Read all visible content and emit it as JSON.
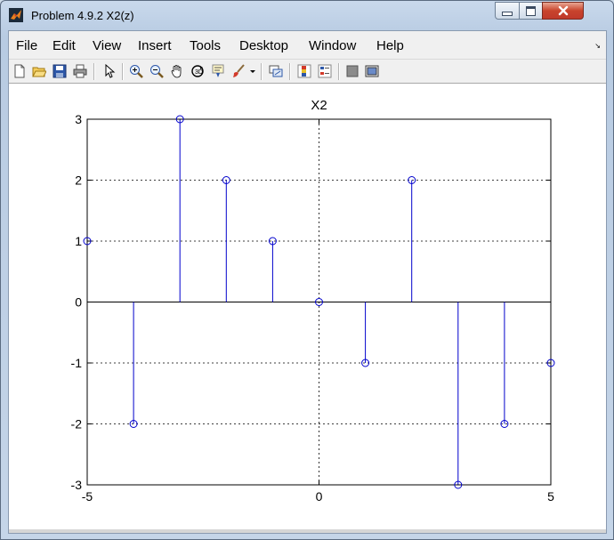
{
  "window": {
    "title": "Problem 4.9.2 X2(z)",
    "controls": {
      "minimize": "minimize",
      "maximize": "maximize",
      "close": "close"
    }
  },
  "menu": [
    "File",
    "Edit",
    "View",
    "Insert",
    "Tools",
    "Desktop",
    "Window",
    "Help"
  ],
  "toolbar": {
    "icons": [
      "new-figure-icon",
      "open-file-icon",
      "save-icon",
      "print-icon",
      "pointer-icon",
      "zoom-in-icon",
      "zoom-out-icon",
      "pan-hand-icon",
      "rotate-3d-icon",
      "data-cursor-icon",
      "brush-icon",
      "brush-dropdown-icon",
      "link-plot-icon",
      "colorbar-icon",
      "legend-icon",
      "hide-plot-tools-icon",
      "show-plot-tools-icon"
    ]
  },
  "colors": {
    "stem": "#0000cc",
    "axes": "#000000",
    "grid": "#000000",
    "background": "#ffffff"
  },
  "chart_data": {
    "type": "stem",
    "title": "X2",
    "xlabel": "",
    "ylabel": "",
    "x": [
      -5,
      -4,
      -3,
      -2,
      -1,
      0,
      1,
      2,
      3,
      4,
      5
    ],
    "y": [
      1,
      -2,
      3,
      2,
      1,
      0,
      -1,
      2,
      -3,
      -2,
      -1
    ],
    "xlim": [
      -5,
      5
    ],
    "ylim": [
      -3,
      3
    ],
    "xticks": [
      -5,
      0,
      5
    ],
    "yticks": [
      -3,
      -2,
      -1,
      0,
      1,
      2,
      3
    ],
    "grid": true,
    "marker": "circle-open"
  }
}
